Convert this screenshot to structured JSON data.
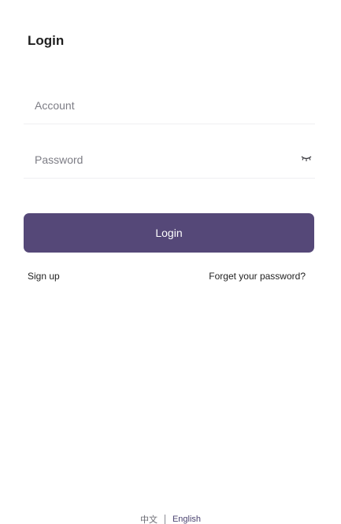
{
  "header": {
    "title": "Login"
  },
  "form": {
    "account": {
      "placeholder": "Account",
      "value": ""
    },
    "password": {
      "placeholder": "Password",
      "value": "",
      "toggle_icon": "eye-closed-icon"
    },
    "login_label": "Login"
  },
  "links": {
    "signup": "Sign up",
    "forget_password": "Forget your password?"
  },
  "language": {
    "chinese": "中文",
    "english": "English",
    "selected": "English"
  },
  "colors": {
    "primary": "#554878",
    "background": "#ffffff",
    "text": "#1f1f1f",
    "placeholder": "#7d7d85"
  }
}
